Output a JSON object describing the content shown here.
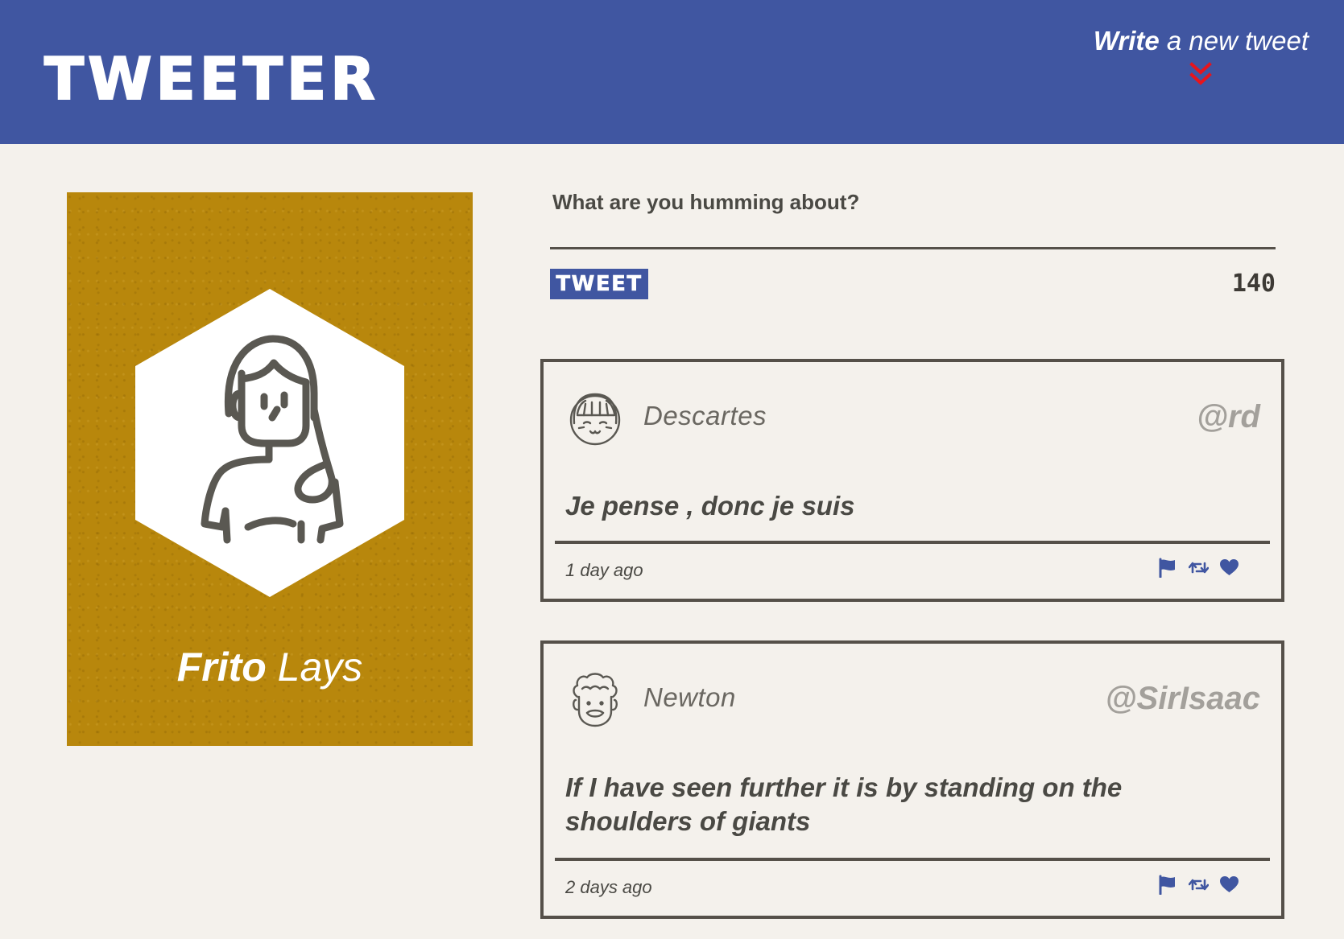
{
  "header": {
    "brand": "TWEETER",
    "compose_toggle": {
      "bold_word": "Write",
      "rest": " a new tweet",
      "icon": "double-chevron-down-icon",
      "icon_color": "#e8141b"
    },
    "background_color": "#4056a1"
  },
  "profile": {
    "first_name": "Frito",
    "last_name": " Lays",
    "avatar_icon": "woman-avatar-icon",
    "card_color": "#b8870c"
  },
  "composer": {
    "placeholder": "What are you humming about?",
    "submit_label": "TWEET",
    "char_counter": "140"
  },
  "tweets": [
    {
      "author_name": "Descartes",
      "handle": "@rd",
      "avatar_icon": "girl-avatar-icon",
      "content": "Je pense , donc je suis",
      "timestamp": "1 day ago",
      "actions": [
        "flag-icon",
        "retweet-icon",
        "heart-icon"
      ]
    },
    {
      "author_name": "Newton",
      "handle": "@SirIsaac",
      "avatar_icon": "curly-hair-avatar-icon",
      "content": "If I have seen further it is by standing on the shoulders of giants",
      "timestamp": "2 days ago",
      "actions": [
        "flag-icon",
        "retweet-icon",
        "heart-icon"
      ]
    }
  ],
  "colors": {
    "accent": "#4056a1",
    "page_background": "#f4f1ec",
    "text": "#4a4944",
    "border": "#555049",
    "handle": "#a3a09b"
  }
}
